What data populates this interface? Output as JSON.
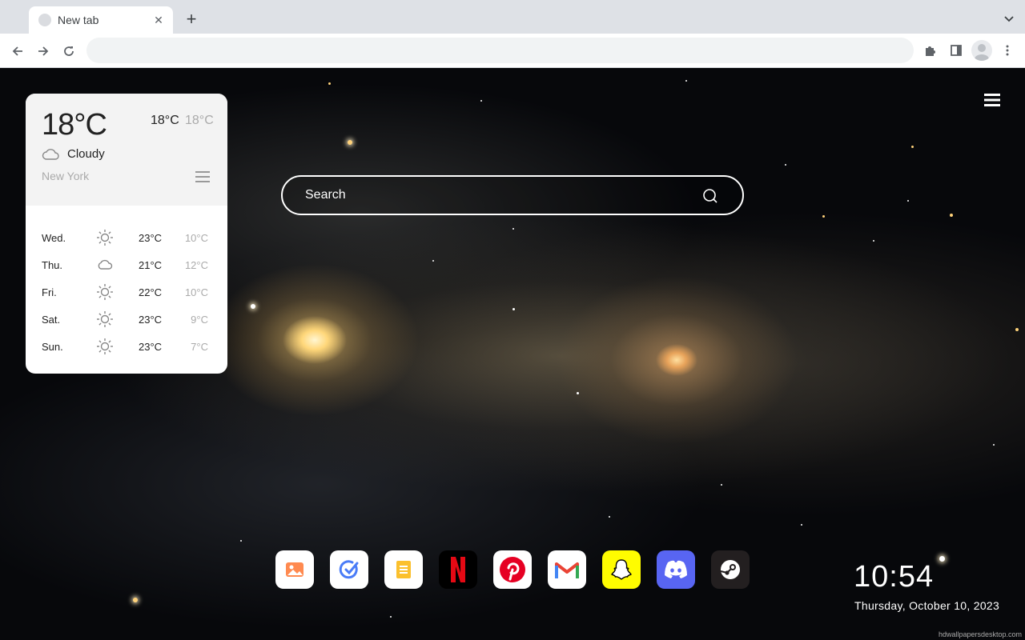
{
  "browser": {
    "tab_title": "New tab",
    "new_tab_symbol": "+",
    "close_symbol": "✕",
    "address_value": ""
  },
  "weather": {
    "current_temp": "18°C",
    "high": "18°C",
    "low": "18°C",
    "condition": "Cloudy",
    "condition_icon": "cloud-icon",
    "city": "New York",
    "forecast": [
      {
        "day": "Wed.",
        "icon": "sun-icon",
        "high": "23°C",
        "low": "10°C"
      },
      {
        "day": "Thu.",
        "icon": "cloud-icon",
        "high": "21°C",
        "low": "12°C"
      },
      {
        "day": "Fri.",
        "icon": "sun-icon",
        "high": "22°C",
        "low": "10°C"
      },
      {
        "day": "Sat.",
        "icon": "sun-icon",
        "high": "23°C",
        "low": "9°C"
      },
      {
        "day": "Sun.",
        "icon": "sun-icon",
        "high": "23°C",
        "low": "7°C"
      }
    ]
  },
  "search": {
    "placeholder": "Search"
  },
  "dock": {
    "apps": [
      {
        "name": "photos",
        "icon": "image-icon",
        "bg": "#ffffff"
      },
      {
        "name": "tasks",
        "icon": "check-circle-icon",
        "bg": "#ffffff"
      },
      {
        "name": "notes",
        "icon": "note-icon",
        "bg": "#ffffff"
      },
      {
        "name": "netflix",
        "icon": "netflix-icon",
        "bg": "#000000",
        "glyph": "N"
      },
      {
        "name": "pinterest",
        "icon": "pinterest-icon",
        "bg": "#ffffff",
        "glyph": "P"
      },
      {
        "name": "gmail",
        "icon": "gmail-icon",
        "bg": "#ffffff"
      },
      {
        "name": "snapchat",
        "icon": "snapchat-icon",
        "bg": "#fffc00"
      },
      {
        "name": "discord",
        "icon": "discord-icon",
        "bg": "#5865f2"
      },
      {
        "name": "steam",
        "icon": "steam-icon",
        "bg": "#231f20"
      }
    ]
  },
  "clock": {
    "time": "10:54",
    "date": "Thursday, October 10, 2023"
  },
  "credit": "hdwallpapersdesktop.com",
  "colors": {
    "netflix_red": "#e50914",
    "pinterest_red": "#e60023",
    "discord_blurple": "#5865f2",
    "snapchat_yellow": "#fffc00"
  }
}
